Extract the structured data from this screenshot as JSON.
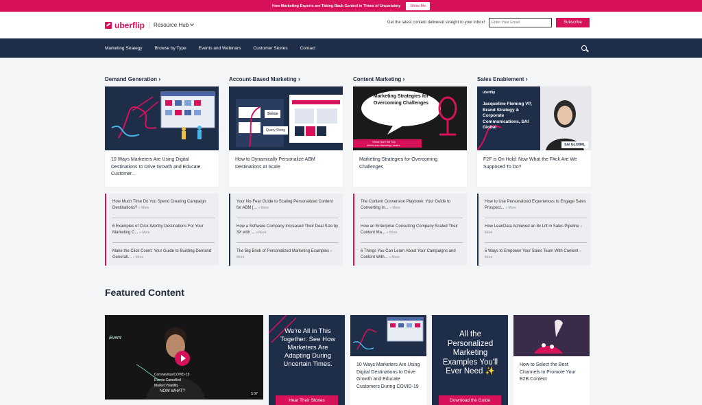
{
  "promo": {
    "text": "How Marketing Experts are Taking Back Control in Times of Uncertainty",
    "button": "Show Me"
  },
  "header": {
    "logo": "uberflip",
    "hub": "Resource Hub",
    "subscribe_text": "Get the latest content delivered straight to your inbox!",
    "email_placeholder": "Enter Your Email",
    "subscribe_button": "Subscribe"
  },
  "nav": {
    "items": [
      "Marketing Strategy",
      "Browse by Type",
      "Events and Webinars",
      "Customer Stories",
      "Contact"
    ]
  },
  "columns": [
    {
      "title": "Demand Generation",
      "card_title": "10 Ways Marketers Are Using Digital Destinations to Drive Growth and Educate Customer...",
      "links": [
        {
          "text": "How Much Time Do You Spend Creating Campaign Destinations?",
          "more": "» More"
        },
        {
          "text": "6 Examples of Click-Worthy Destinations For Your Marketing C...",
          "more": "» More"
        },
        {
          "text": "Make the Click Count: Your Guide to Building Demand Generati...",
          "more": "» More"
        }
      ]
    },
    {
      "title": "Account-Based Marketing",
      "card_title": "How to Dynamically Personalize ABM Destinations at Scale",
      "thumb_labels": [
        "Sonos",
        "Query String"
      ],
      "links": [
        {
          "text": "Your No-Fear Guide to Scaling Personalized Content for ABM [...",
          "more": "» More"
        },
        {
          "text": "How a Software Company Increased Their Deal Size by 3X with ...",
          "more": "» More"
        },
        {
          "text": "The Big Book of Personalized Marketing Examples",
          "more": "» More"
        }
      ]
    },
    {
      "title": "Content Marketing",
      "card_title": "Marketing Strategies for Overcoming Challenges",
      "thumb_text": "Marketing Strategies for Overcoming Challenges",
      "thumb_tag": "Views from the Top",
      "thumb_sub": "Advice from Marketing Leaders",
      "links": [
        {
          "text": "The Content Conversion Playbook: Your Guide to Converting In...",
          "more": "» More"
        },
        {
          "text": "How an Enterprise Consulting Company Scaled Their Content Ma...",
          "more": "» More"
        },
        {
          "text": "6 Things You Can Learn About Your Campaigns and Content With...",
          "more": "» More"
        }
      ]
    },
    {
      "title": "Sales Enablement",
      "card_title": "F2F is On Hold: Now What the F#ck Are We Supposed To Do?",
      "thumb_logo": "uberflip",
      "thumb_text": "Jacqueline Fleming VP, Brand Strategy & Corporate Communications, SAI Global",
      "thumb_badge": "SAI GLOBAL",
      "links": [
        {
          "text": "How to Use Personalized Experiences to Engage Sales Prospect...",
          "more": "» More"
        },
        {
          "text": "How LeanData Achieved an 8x Lift in Sales Pipeline",
          "more": "» More"
        },
        {
          "text": "6 Ways to Empower Your Sales Team With Content",
          "more": "» More"
        }
      ]
    }
  ],
  "featured": {
    "title": "Featured Content",
    "video": {
      "duration": "5:37",
      "board_lines": [
        "Event",
        "Coronavirus/COVID-19",
        "Events Cancelled",
        "Market Volatility",
        "NOW WHAT?"
      ]
    },
    "cards": [
      {
        "text": "We're All in This Together. See How Marketers Are Adapting During Uncertain Times.",
        "button": "Hear Their Stories"
      },
      {
        "text": "10 Ways Marketers Are Using Digital Destinations to Drive Growth and Educate Customers During COVID-19"
      },
      {
        "text": "All the Personalized Marketing Examples You'll Ever Need ✨",
        "button": "Download the Guide"
      },
      {
        "text": "How to Select the Best Channels to Promote Your B2B Content"
      }
    ]
  },
  "colors": {
    "accent": "#d7125b",
    "navy": "#1e2d48"
  }
}
